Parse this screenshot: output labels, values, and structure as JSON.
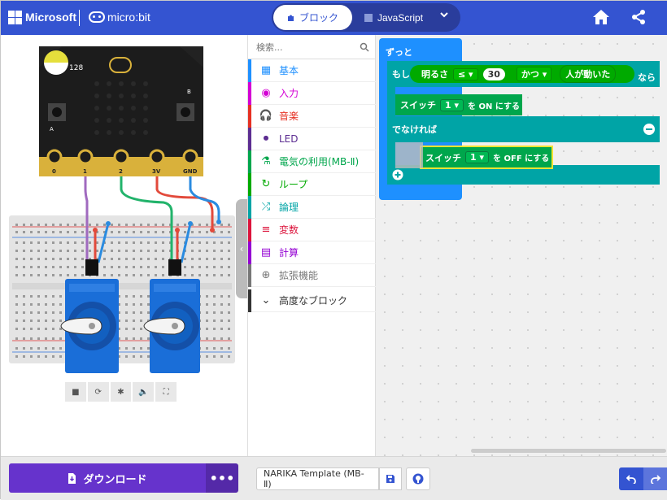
{
  "header": {
    "brand": "Microsoft",
    "product": "micro:bit",
    "tab_blocks": "ブロック",
    "tab_javascript": "JavaScript",
    "accent_color": "#3454d1"
  },
  "simulator": {
    "light_level": "128",
    "pin_labels": [
      "0",
      "1",
      "2",
      "3V",
      "GND"
    ],
    "button_labels": [
      "A",
      "B"
    ],
    "toolbar_icons": [
      "stop-icon",
      "restart-icon",
      "debug-icon",
      "sound-icon",
      "fullscreen-icon"
    ]
  },
  "toolbox": {
    "search_placeholder": "検索...",
    "categories": [
      {
        "label": "基本",
        "color": "#1e90ff",
        "icon": "grid-icon"
      },
      {
        "label": "入力",
        "color": "#d400d4",
        "icon": "input-icon"
      },
      {
        "label": "音楽",
        "color": "#e63022",
        "icon": "headphones-icon"
      },
      {
        "label": "LED",
        "color": "#5c2d91",
        "icon": "toggle-icon"
      },
      {
        "label": "電気の利用(MB-Ⅱ)",
        "color": "#00a64c",
        "icon": "flask-icon"
      },
      {
        "label": "ループ",
        "color": "#00aa00",
        "icon": "loop-icon"
      },
      {
        "label": "論理",
        "color": "#00a4a6",
        "icon": "shuffle-icon"
      },
      {
        "label": "変数",
        "color": "#dc143c",
        "icon": "variable-icon"
      },
      {
        "label": "計算",
        "color": "#9400d3",
        "icon": "calculator-icon"
      },
      {
        "label": "拡張機能",
        "color": "#777777",
        "icon": "plus-circle-icon"
      },
      {
        "label": "高度なブロック",
        "color": "#333333",
        "icon": "chevron-down-icon"
      }
    ]
  },
  "workspace": {
    "forever": "ずっと",
    "if": "もし",
    "light": "明るさ",
    "operator": "≤",
    "value": "30",
    "and": "かつ",
    "person_moved": "人が動いた",
    "then": "なら",
    "switch1": "スイッチ",
    "switch1_num": "1",
    "on_text": "を ON にする",
    "else": "でなければ",
    "switch2": "スイッチ",
    "switch2_num": "1",
    "off_text": "を OFF にする"
  },
  "footer": {
    "download_label": "ダウンロード",
    "more_label": "•••",
    "project_name": "NARIKA Template (MB-Ⅱ)"
  }
}
